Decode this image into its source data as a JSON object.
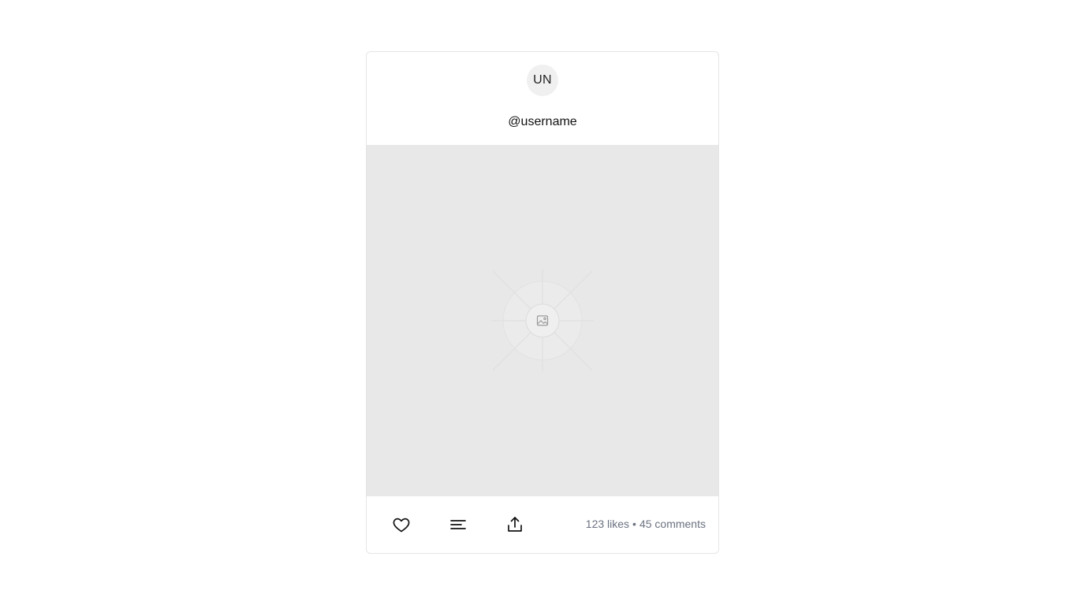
{
  "post": {
    "avatar_initials": "UN",
    "username": "@username",
    "image_placeholder_icon": "image-icon",
    "actions": {
      "like_icon": "heart-icon",
      "comment_icon": "comment-lines-icon",
      "share_icon": "share-icon"
    },
    "stats": {
      "likes": "123 likes",
      "separator": "•",
      "comments": "45 comments"
    }
  },
  "colors": {
    "placeholder_bg": "#e8e8e8",
    "stats_text": "#6b7280",
    "card_border": "#e5e5e5"
  }
}
